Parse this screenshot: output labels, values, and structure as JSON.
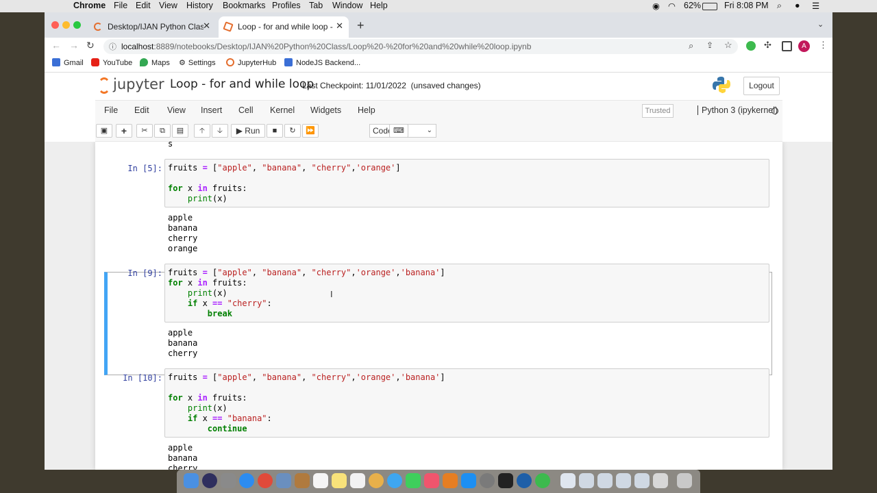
{
  "macmenu": {
    "app": "Chrome",
    "items": [
      "File",
      "Edit",
      "View",
      "History",
      "Bookmarks",
      "Profiles",
      "Tab",
      "Window",
      "Help"
    ],
    "battery": "62%",
    "clock": "Fri 8:08 PM"
  },
  "browser": {
    "tabs": [
      {
        "title": "Desktop/IJAN Python Class/"
      },
      {
        "title": "Loop - for and while loop - Jup"
      }
    ],
    "url_host": "localhost",
    "url_rest": ":8889/notebooks/Desktop/IJAN%20Python%20Class/Loop%20-%20for%20and%20while%20loop.ipynb",
    "bookmarks": [
      "Gmail",
      "YouTube",
      "Maps",
      "Settings",
      "JupyterHub",
      "NodeJS Backend..."
    ]
  },
  "jupyter": {
    "logo": "jupyter",
    "notebook_title": "Loop - for and while loop",
    "checkpoint": "Last Checkpoint: 11/01/2022",
    "unsaved": "(unsaved changes)",
    "logout": "Logout",
    "menu": [
      "File",
      "Edit",
      "View",
      "Insert",
      "Cell",
      "Kernel",
      "Widgets",
      "Help"
    ],
    "trusted": "Trusted",
    "kernel": "Python 3 (ipykernel)",
    "run_label": "Run",
    "cell_type": "Code"
  },
  "cells": {
    "prev_output_tail": "s",
    "c5": {
      "prompt": "In [5]:",
      "output": "apple\nbanana\ncherry\norange"
    },
    "c9": {
      "prompt": "In [9]:",
      "output": "apple\nbanana\ncherry"
    },
    "c10": {
      "prompt": "In [10]:",
      "output": "apple\nbanana\ncherry"
    }
  },
  "colors": {
    "selected_cell_border": "#42a5f5",
    "keyword": "#008000",
    "string": "#ba2121",
    "prompt": "#303f9f"
  }
}
